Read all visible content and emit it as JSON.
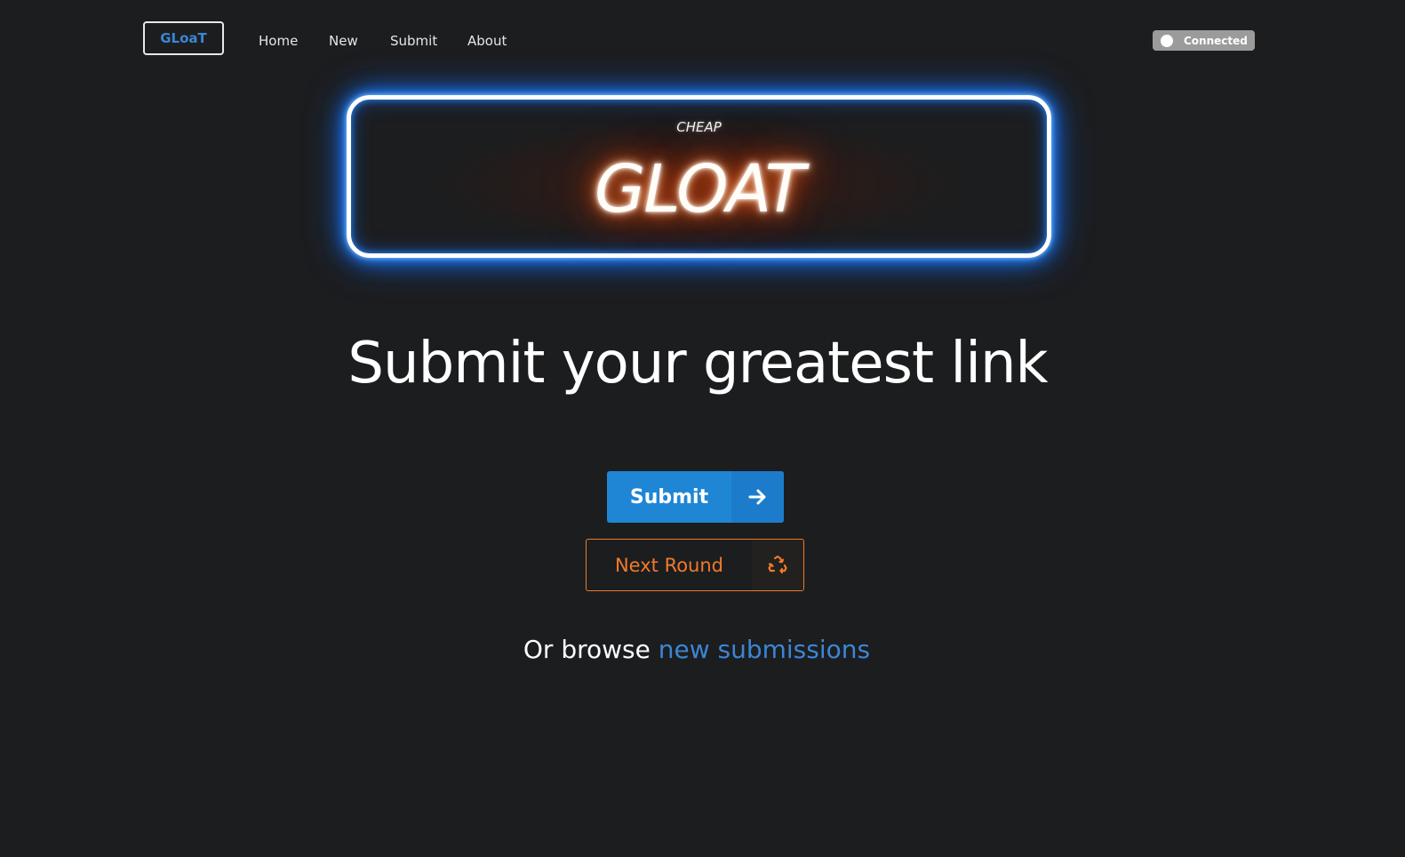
{
  "navbar": {
    "brand": "GLoaT",
    "links": [
      "Home",
      "New",
      "Submit",
      "About"
    ],
    "status_toggle": {
      "label": "Connected",
      "on": true
    }
  },
  "hero": {
    "sign_subtitle": "CHEAP",
    "sign_title": "GLOAT",
    "headline": "Submit your greatest link"
  },
  "actions": {
    "submit_label": "Submit",
    "submit_icon": "arrow-right-icon",
    "next_round_label": "Next Round",
    "next_round_icon": "recycle-icon"
  },
  "browse": {
    "prefix": "Or browse",
    "link_text": "new submissions"
  },
  "colors": {
    "background": "#1c1d1f",
    "primary_blue": "#1f86d6",
    "link_blue": "#3b86d4",
    "accent_orange": "#f07a2a",
    "neon_blue": "#1473ff",
    "neon_orange": "#ff6a20"
  }
}
